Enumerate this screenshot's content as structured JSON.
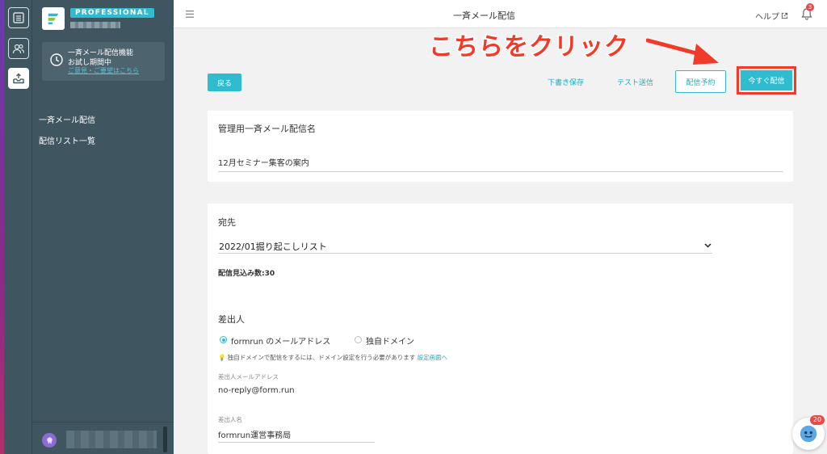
{
  "sidebar": {
    "plan_badge": "PROFESSIONAL",
    "trial": {
      "line1": "一斉メール配信機能",
      "line2": "お試し期間中",
      "link": "ご意見・ご要望はこちら"
    },
    "nav": [
      {
        "label": "一斉メール配信"
      },
      {
        "label": "配信リスト一覧"
      }
    ]
  },
  "header": {
    "title": "一斉メール配信",
    "help_label": "ヘルプ",
    "notification_count": "3"
  },
  "annotation": {
    "text": "こちらをクリック",
    "color": "#f03a2a"
  },
  "toolbar": {
    "back_label": "戻る",
    "draft_label": "下書き保存",
    "test_label": "テスト送信",
    "schedule_label": "配信予約",
    "send_now_label": "今すぐ配信"
  },
  "form": {
    "name_label": "管理用一斉メール配信名",
    "name_value": "12月セミナー集客の案内",
    "recipient_label": "宛先",
    "recipient_value": "2022/01掘り起こしリスト",
    "estimated_count": "配信見込み数:30",
    "sender_label": "差出人",
    "radio_formrun": "formrun のメールアドレス",
    "radio_custom": "独自ドメイン",
    "hint_text": "独自ドメインで配信をするには、ドメイン設定を行う必要があります",
    "hint_link": "設定画面へ",
    "sender_email_label": "差出人メールアドレス",
    "sender_email_value": "no-reply@form.run",
    "sender_name_label": "差出人名",
    "sender_name_value": "formrun運営事務局"
  },
  "chat": {
    "badge_count": "20"
  },
  "colors": {
    "accent": "#2fbcd0",
    "sidebar": "#3f5560",
    "highlight": "#f03a2a"
  }
}
